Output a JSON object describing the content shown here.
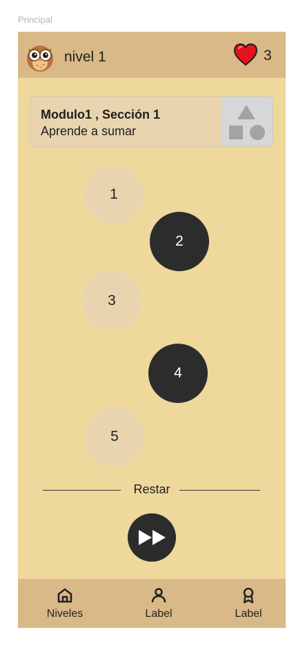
{
  "frame_label": "Principal",
  "header": {
    "level_title": "nivel 1",
    "lives": "3",
    "mascot_icon": "owl-icon",
    "lives_icon": "heart-icon",
    "heart_color": "#e6121c"
  },
  "module": {
    "title": "Modulo1 ,  Sección 1",
    "subtitle": "Aprende a sumar",
    "thumbnail_icon": "shapes-placeholder-icon"
  },
  "steps": [
    {
      "label": "1",
      "state": "light"
    },
    {
      "label": "2",
      "state": "dark"
    },
    {
      "label": "3",
      "state": "light"
    },
    {
      "label": "4",
      "state": "dark"
    },
    {
      "label": "5",
      "state": "light"
    }
  ],
  "section_divider": {
    "label": "Restar"
  },
  "play_button": {
    "icon": "fast-forward-icon"
  },
  "bottom_nav": [
    {
      "label": "Niveles",
      "icon": "home-icon"
    },
    {
      "label": "Label",
      "icon": "user-icon"
    },
    {
      "label": "Label",
      "icon": "award-icon"
    }
  ],
  "colors": {
    "background": "#eed89c",
    "bars": "#d9b987",
    "light_step": "#e8d5b0",
    "dark_step": "#2c2c2c"
  }
}
